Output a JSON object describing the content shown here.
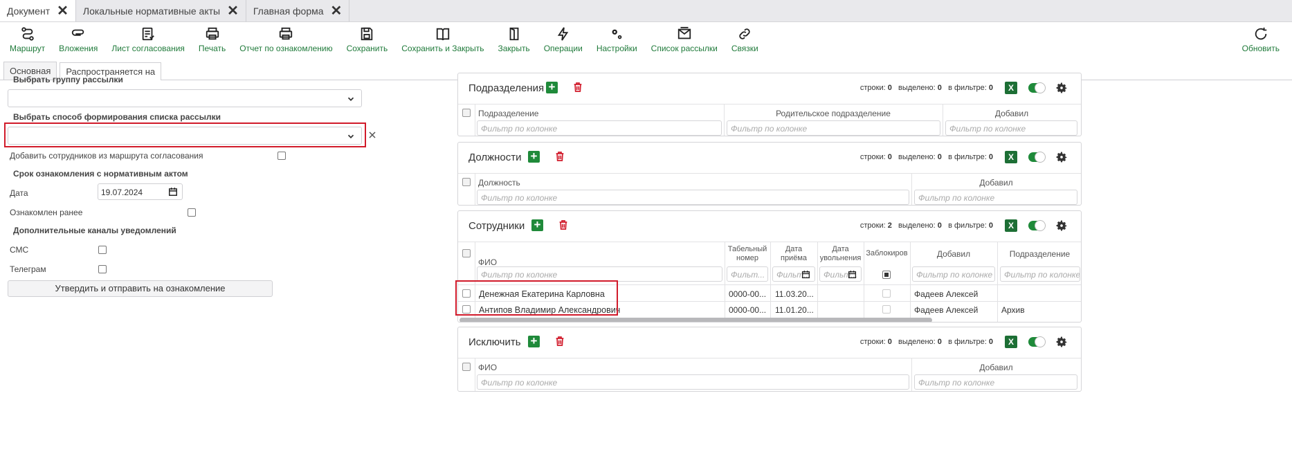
{
  "tabs": [
    {
      "label": "Документ"
    },
    {
      "label": "Локальные нормативные акты"
    },
    {
      "label": "Главная форма"
    }
  ],
  "toolbar": {
    "items": [
      "Маршрут",
      "Вложения",
      "Лист согласования",
      "Печать",
      "Отчет по ознакомлению",
      "Сохранить",
      "Сохранить и Закрыть",
      "Закрыть",
      "Операции",
      "Настройки",
      "Список рассылки",
      "Связки"
    ],
    "refresh": "Обновить"
  },
  "subtabs": {
    "main": "Основная",
    "spread": "Распространяется на"
  },
  "form": {
    "group_label": "Выбрать группу рассылки",
    "method_label": "Выбрать способ формирования списка рассылки",
    "add_from_route": "Добавить сотрудников из маршрута согласования",
    "deadline_header": "Срок ознакомления с нормативным актом",
    "date_label": "Дата",
    "date_value": "19.07.2024",
    "acquainted_label": "Ознакомлен ранее",
    "channels_header": "Дополнительные каналы уведомлений",
    "sms_label": "СМС",
    "telegram_label": "Телеграм",
    "confirm_button": "Утвердить и отправить на ознакомление"
  },
  "stats_labels": {
    "rows": "строки:",
    "selected": "выделено:",
    "filtered": "в фильтре:"
  },
  "filter_placeholder": "Фильтр по колонке",
  "filter_short": "Фильт...",
  "panels": {
    "divisions": {
      "title": "Подразделения",
      "rows": "0",
      "selected": "0",
      "filtered": "0",
      "cols": [
        "Подразделение",
        "Родительское подразделение",
        "Добавил"
      ]
    },
    "positions": {
      "title": "Должности",
      "rows": "0",
      "selected": "0",
      "filtered": "0",
      "cols": [
        "Должность",
        "Добавил"
      ]
    },
    "employees": {
      "title": "Сотрудники",
      "rows": "2",
      "selected": "0",
      "filtered": "0",
      "cols": {
        "fio": "ФИО",
        "tab1": "Табельный",
        "tab2": "номер",
        "hire1": "Дата",
        "hire2": "приёма",
        "fire1": "Дата",
        "fire2": "увольнения",
        "blocked": "Заблокиров",
        "added": "Добавил",
        "division": "Подразделение"
      },
      "data": [
        {
          "fio": "Денежная Екатерина Карловна",
          "tab": "0000-00...",
          "hire": "11.03.20...",
          "added": "Фадеев Алексей",
          "division": ""
        },
        {
          "fio": "Антипов Владимир Александрович",
          "tab": "0000-00...",
          "hire": "11.01.20...",
          "added": "Фадеев Алексей",
          "division": "Архив"
        }
      ]
    },
    "exclude": {
      "title": "Исключить",
      "rows": "0",
      "selected": "0",
      "filtered": "0",
      "cols": [
        "ФИО",
        "Добавил"
      ]
    }
  },
  "colors": {
    "accent": "#1f7a3a",
    "delete": "#d11a2a",
    "highlight": "#d11a2a"
  }
}
